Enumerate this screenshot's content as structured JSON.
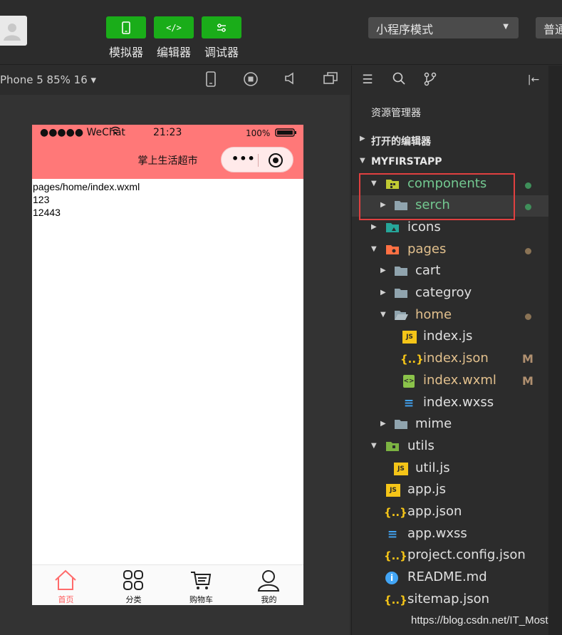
{
  "toolbar": {
    "buttons": [
      {
        "label": "模拟器",
        "icon": "phone-icon"
      },
      {
        "label": "编辑器",
        "icon": "code-icon"
      },
      {
        "label": "调试器",
        "icon": "settings-sliders-icon"
      }
    ],
    "mode_select": "小程序模式",
    "compile_label": "普通"
  },
  "simulator": {
    "device": "Phone 5 85% 16 ▾",
    "status": {
      "carrier": "●●●●● WeChat",
      "time": "21:23",
      "battery": "100%"
    },
    "nav_title": "掌上生活超市",
    "capsule_dots": "•••",
    "page_lines": [
      "pages/home/index.wxml",
      "123",
      "12443"
    ],
    "tabs": [
      {
        "label": "首页",
        "icon": "home-icon",
        "active": true
      },
      {
        "label": "分类",
        "icon": "grid-icon",
        "active": false
      },
      {
        "label": "购物车",
        "icon": "cart-icon",
        "active": false
      },
      {
        "label": "我的",
        "icon": "user-icon",
        "active": false
      }
    ]
  },
  "explorer": {
    "title": "资源管理器",
    "open_editors": "打开的编辑器",
    "project": "MYFIRSTAPP",
    "tree": [
      {
        "name": "components",
        "type": "folder",
        "open": true,
        "status_dot": "#3f8f5a",
        "color": "#73c991"
      },
      {
        "name": "serch",
        "type": "folder",
        "open": false,
        "status_dot": "#3f8f5a",
        "color": "#73c991"
      },
      {
        "name": "icons",
        "type": "folder",
        "open": false
      },
      {
        "name": "pages",
        "type": "folder",
        "open": true,
        "status_dot": "#8a7355",
        "color": "#e2c08d"
      },
      {
        "name": "cart",
        "type": "folder",
        "open": false
      },
      {
        "name": "categroy",
        "type": "folder",
        "open": false
      },
      {
        "name": "home",
        "type": "folder",
        "open": true,
        "status_dot": "#8a7355",
        "color": "#e2c08d"
      },
      {
        "name": "index.js",
        "type": "js"
      },
      {
        "name": "index.json",
        "type": "json",
        "mark": "M",
        "color": "#e2c08d"
      },
      {
        "name": "index.wxml",
        "type": "wxml",
        "mark": "M",
        "color": "#e2c08d"
      },
      {
        "name": "index.wxss",
        "type": "wxss"
      },
      {
        "name": "mime",
        "type": "folder",
        "open": false
      },
      {
        "name": "utils",
        "type": "folder",
        "open": true
      },
      {
        "name": "util.js",
        "type": "js"
      },
      {
        "name": "app.js",
        "type": "js"
      },
      {
        "name": "app.json",
        "type": "json"
      },
      {
        "name": "app.wxss",
        "type": "wxss"
      },
      {
        "name": "project.config.json",
        "type": "json"
      },
      {
        "name": "README.md",
        "type": "info"
      },
      {
        "name": "sitemap.json",
        "type": "json"
      }
    ]
  },
  "watermark": "https://blog.csdn.net/IT_Most"
}
